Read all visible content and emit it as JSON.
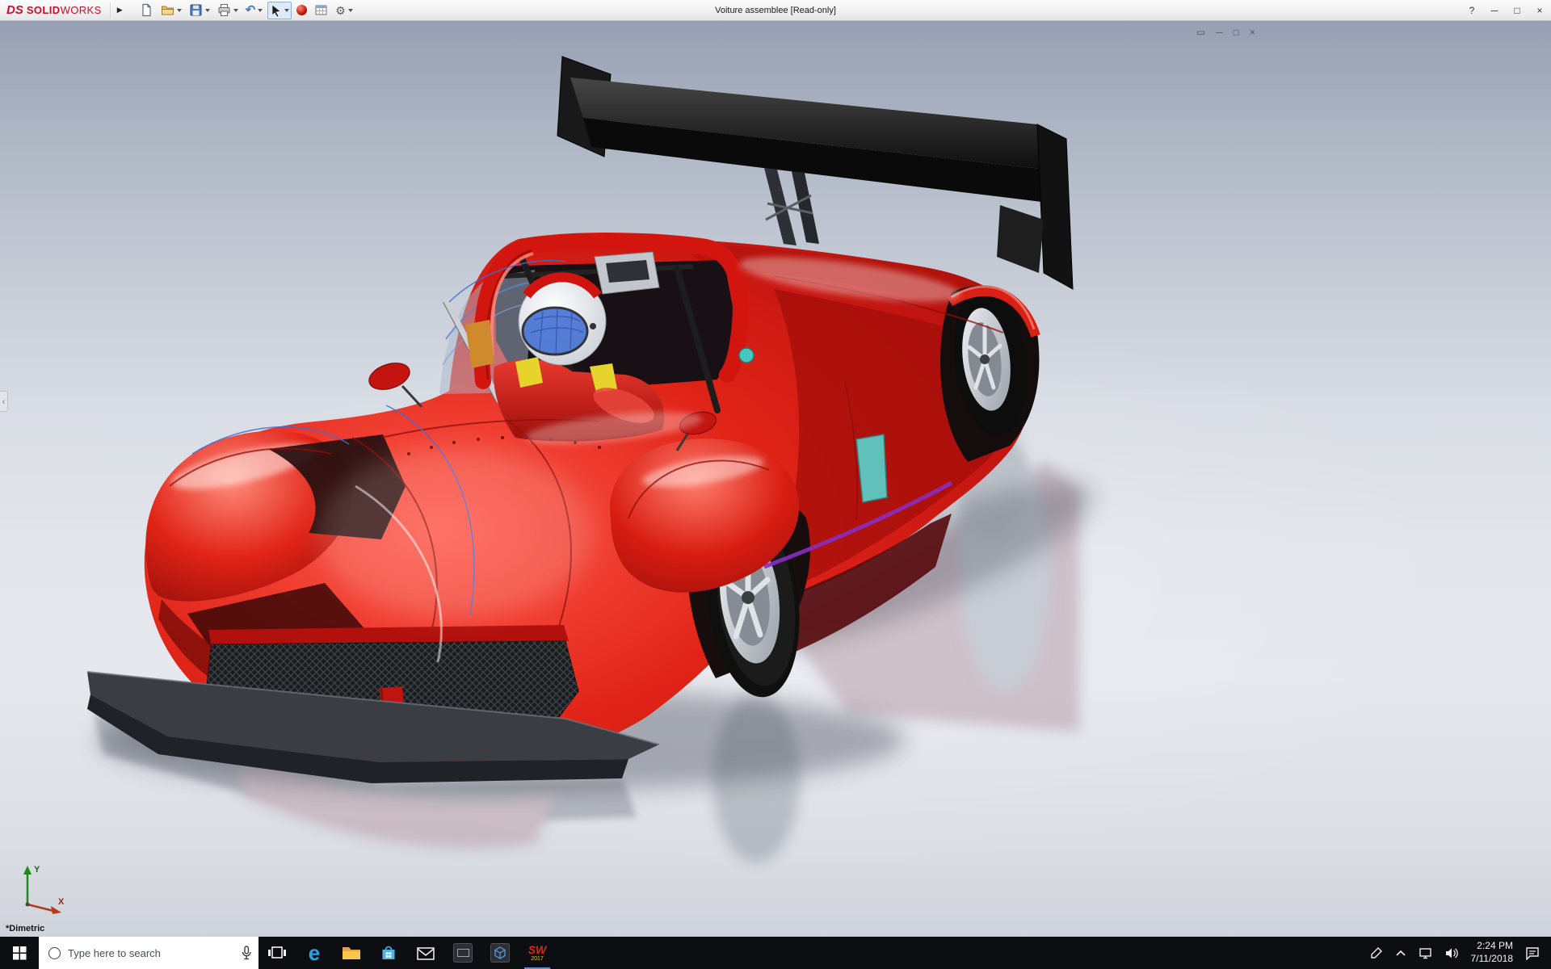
{
  "titlebar": {
    "logo": {
      "ds": "DS",
      "solid": "SOLID",
      "works": "WORKS"
    },
    "flyout_glyph": "▶",
    "title": "Voiture assemblee [Read-only]",
    "undo_glyph": "↶",
    "options_glyph": "⚙",
    "help_glyph": "?",
    "minimize_glyph": "─",
    "maximize_glyph": "□",
    "close_glyph": "×",
    "toolbar_icons": [
      "new-document",
      "open",
      "save",
      "print",
      "undo",
      "select",
      "appearance-sphere",
      "design-table",
      "options"
    ]
  },
  "viewport": {
    "doc_controls": [
      "▭",
      "─",
      "□",
      "×"
    ],
    "collapse_glyph": "‹",
    "view_label": "*Dimetric",
    "triad": {
      "x": "X",
      "y": "Y"
    }
  },
  "taskbar": {
    "search_placeholder": "Type here to search",
    "apps": [
      "task-view",
      "edge",
      "file-explorer",
      "store",
      "mail",
      "dark-app",
      "blue-cube-app",
      "solidworks"
    ],
    "edge_glyph": "e",
    "sw_label": "SW",
    "sw_year": "2017",
    "clock_time": "2:24 PM",
    "clock_date": "7/11/2018"
  },
  "colors": {
    "car_red": "#d41712",
    "car_red_dark": "#9c0f0c",
    "wing_black": "#151515",
    "visor_blue": "#4a74d4",
    "suit_yellow": "#e6d42c",
    "accent_teal": "#45c8c0",
    "glass_cyan": "#5ecac4",
    "trim_purple": "#8a2ec0"
  }
}
